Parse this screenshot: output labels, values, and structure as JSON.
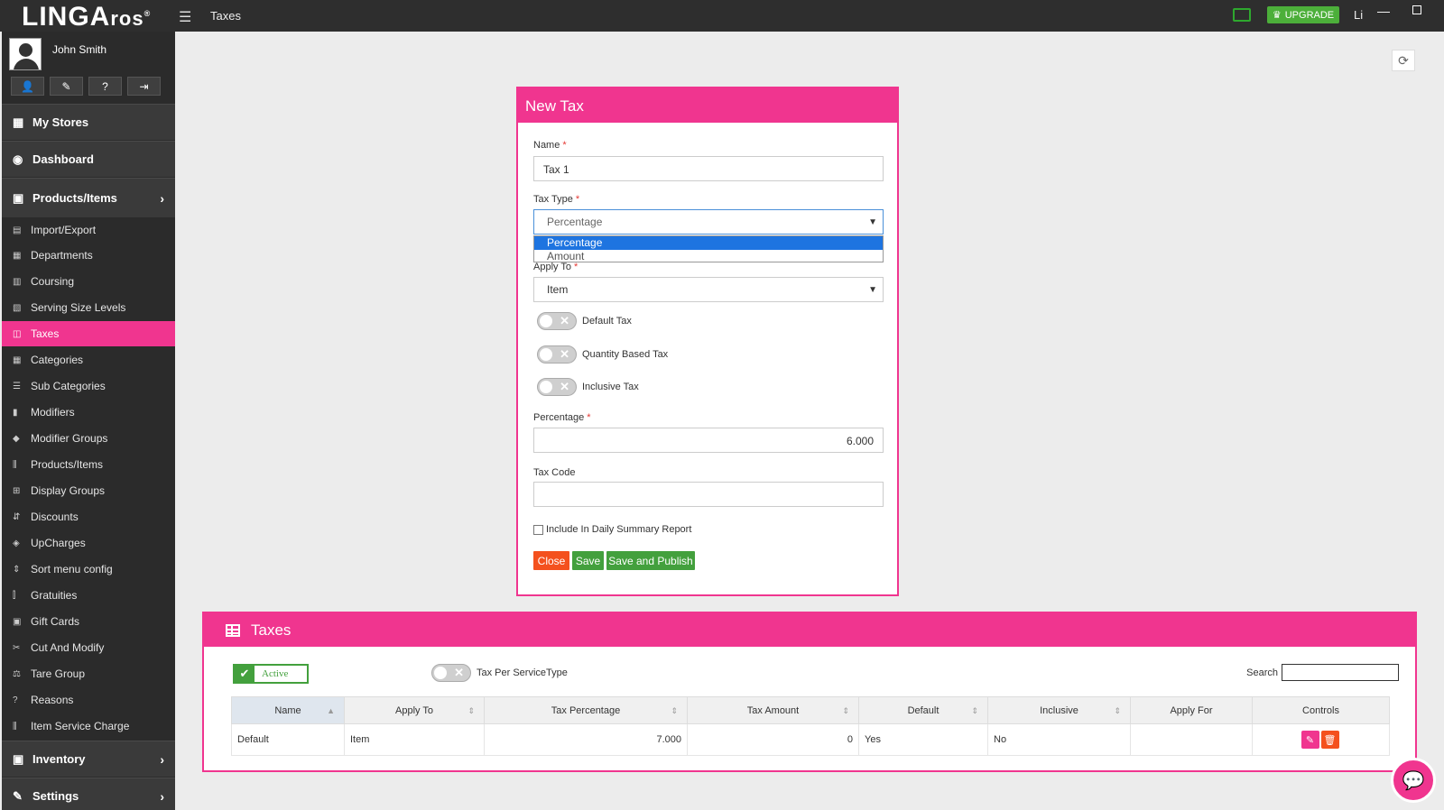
{
  "app": {
    "logo_main": "LINGA",
    "logo_sub": "ros",
    "logo_mark": "®",
    "page_title": "Taxes"
  },
  "topbar": {
    "upgrade_label": "UPGRADE",
    "user_truncated": "Li"
  },
  "user": {
    "name": "John Smith"
  },
  "sidebar": {
    "main_items": [
      {
        "label": "My Stores",
        "icon": "store-icon"
      },
      {
        "label": "Dashboard",
        "icon": "dashboard-icon"
      },
      {
        "label": "Products/Items",
        "icon": "gift-icon"
      }
    ],
    "sub_items": [
      {
        "label": "Import/Export"
      },
      {
        "label": "Departments"
      },
      {
        "label": "Coursing"
      },
      {
        "label": "Serving Size Levels"
      },
      {
        "label": "Taxes",
        "active": true
      },
      {
        "label": "Categories"
      },
      {
        "label": "Sub Categories"
      },
      {
        "label": "Modifiers"
      },
      {
        "label": "Modifier Groups"
      },
      {
        "label": "Products/Items"
      },
      {
        "label": "Display Groups"
      },
      {
        "label": "Discounts"
      },
      {
        "label": "UpCharges"
      },
      {
        "label": "Sort menu config"
      },
      {
        "label": "Gratuities"
      },
      {
        "label": "Gift Cards"
      },
      {
        "label": "Cut And Modify"
      },
      {
        "label": "Tare Group"
      },
      {
        "label": "Reasons"
      },
      {
        "label": "Item Service Charge"
      }
    ],
    "bottom_items": [
      {
        "label": "Inventory"
      },
      {
        "label": "Settings"
      }
    ]
  },
  "modal": {
    "title": "New Tax",
    "name_label": "Name",
    "name_value": "Tax 1",
    "tax_type_label": "Tax Type",
    "tax_type_value": "Percentage",
    "tax_type_options": [
      "Percentage",
      "Amount"
    ],
    "apply_to_label": "Apply To",
    "apply_to_value": "Item",
    "required_mark": "*",
    "toggles": [
      {
        "label": "Default Tax",
        "on": false
      },
      {
        "label": "Quantity Based Tax",
        "on": false
      },
      {
        "label": "Inclusive Tax",
        "on": false
      }
    ],
    "percentage_label": "Percentage",
    "percentage_value": "6.000",
    "tax_code_label": "Tax Code",
    "tax_code_value": "",
    "daily_summary_label": "Include In Daily Summary Report",
    "close_label": "Close",
    "save_label": "Save",
    "publish_label": "Save and Publish"
  },
  "taxes_panel": {
    "title": "Taxes",
    "active_label": "Active",
    "tax_per_service_label": "Tax Per ServiceType",
    "search_label": "Search",
    "columns": [
      "Name",
      "Apply To",
      "Tax Percentage",
      "Tax Amount",
      "Default",
      "Inclusive",
      "Apply For",
      "Controls"
    ],
    "rows": [
      {
        "name": "Default",
        "apply_to": "Item",
        "tax_percentage": "7.000",
        "tax_amount": "0",
        "default": "Yes",
        "inclusive": "No",
        "apply_for": ""
      }
    ]
  },
  "colors": {
    "accent": "#f0358f",
    "sidebar": "#2b2b2b",
    "green": "#43a03d",
    "orange": "#f4511e"
  }
}
